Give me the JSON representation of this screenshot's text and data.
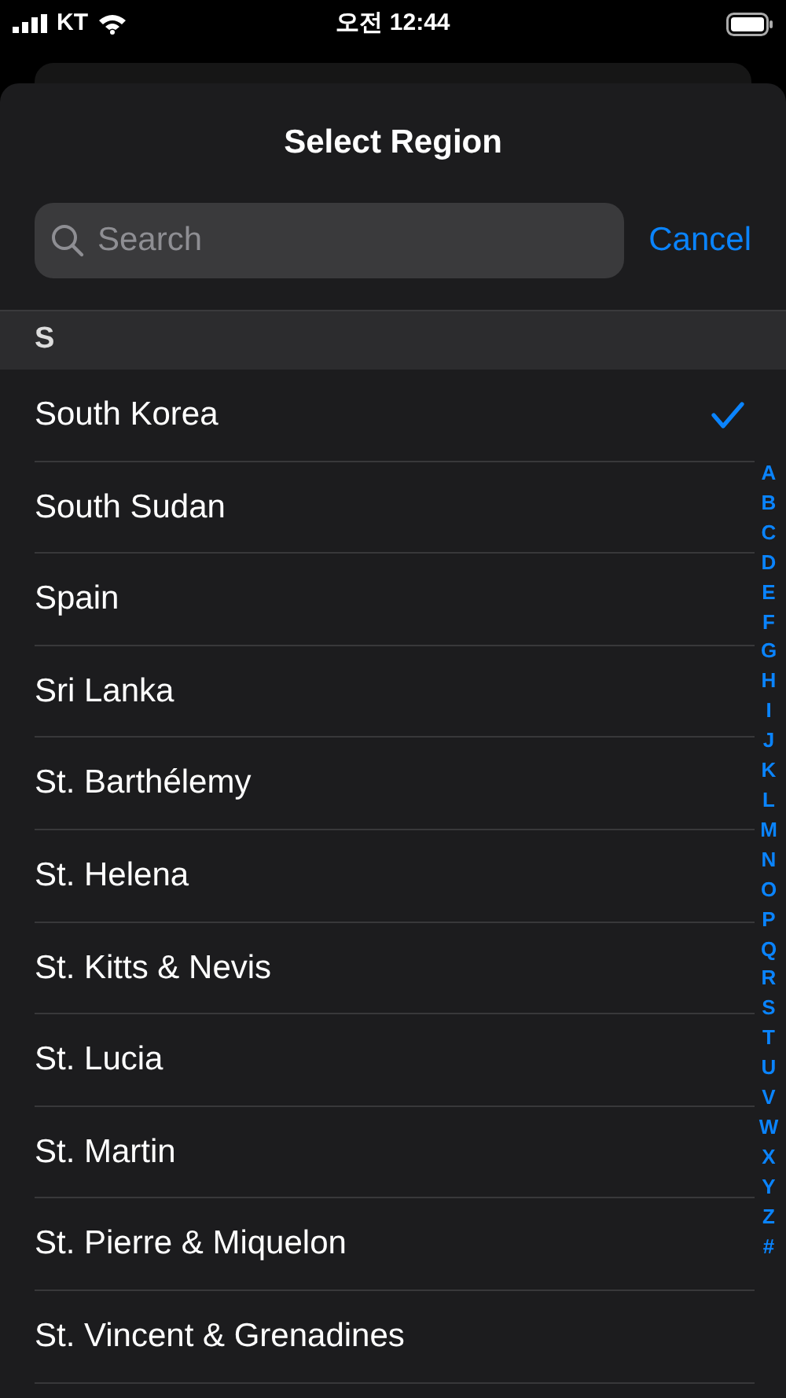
{
  "status_bar": {
    "carrier": "KT",
    "time": "오전 12:44"
  },
  "sheet": {
    "title": "Select Region",
    "search": {
      "placeholder": "Search"
    },
    "cancel": "Cancel"
  },
  "section": {
    "header": "S",
    "rows": [
      {
        "name": "South Korea",
        "selected": true
      },
      {
        "name": "South Sudan",
        "selected": false
      },
      {
        "name": "Spain",
        "selected": false
      },
      {
        "name": "Sri Lanka",
        "selected": false
      },
      {
        "name": "St. Barthélemy",
        "selected": false
      },
      {
        "name": "St. Helena",
        "selected": false
      },
      {
        "name": "St. Kitts & Nevis",
        "selected": false
      },
      {
        "name": "St. Lucia",
        "selected": false
      },
      {
        "name": "St. Martin",
        "selected": false
      },
      {
        "name": "St. Pierre & Miquelon",
        "selected": false
      },
      {
        "name": "St. Vincent & Grenadines",
        "selected": false
      }
    ]
  },
  "index": [
    "A",
    "B",
    "C",
    "D",
    "E",
    "F",
    "G",
    "H",
    "I",
    "J",
    "K",
    "L",
    "M",
    "N",
    "O",
    "P",
    "Q",
    "R",
    "S",
    "T",
    "U",
    "V",
    "W",
    "X",
    "Y",
    "Z",
    "#"
  ]
}
